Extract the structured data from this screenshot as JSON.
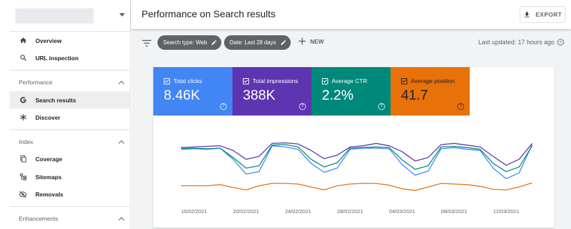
{
  "sidebar": {
    "items_top": [
      {
        "label": "Overview",
        "icon": "home-icon"
      },
      {
        "label": "URL inspection",
        "icon": "search-icon"
      }
    ],
    "sections": [
      {
        "label": "Performance",
        "items": [
          {
            "label": "Search results",
            "icon": "google-g-icon",
            "active": true
          },
          {
            "label": "Discover",
            "icon": "asterisk-icon"
          }
        ]
      },
      {
        "label": "Index",
        "items": [
          {
            "label": "Coverage",
            "icon": "copy-icon"
          },
          {
            "label": "Sitemaps",
            "icon": "sitemap-icon"
          },
          {
            "label": "Removals",
            "icon": "visibility-off-icon"
          }
        ]
      },
      {
        "label": "Enhancements",
        "items": []
      }
    ]
  },
  "header": {
    "title": "Performance on Search results",
    "export_label": "EXPORT"
  },
  "filters": {
    "chips": [
      "Search type: Web",
      "Date: Last 28 days"
    ],
    "new_label": "NEW",
    "last_updated": "Last updated: 17 hours ago"
  },
  "metrics": [
    {
      "label": "Total clicks",
      "value": "8.46K",
      "color": "#4285f4"
    },
    {
      "label": "Total impressions",
      "value": "388K",
      "color": "#5e35b1"
    },
    {
      "label": "Average CTR",
      "value": "2.2%",
      "color": "#00897b"
    },
    {
      "label": "Average position",
      "value": "41.7",
      "color": "#e8710a"
    }
  ],
  "chart_data": {
    "type": "line",
    "x": [
      "15/02/2021",
      "16/02/2021",
      "17/02/2021",
      "18/02/2021",
      "19/02/2021",
      "20/02/2021",
      "21/02/2021",
      "22/02/2021",
      "23/02/2021",
      "24/02/2021",
      "25/02/2021",
      "26/02/2021",
      "27/02/2021",
      "28/02/2021",
      "01/03/2021",
      "02/03/2021",
      "03/03/2021",
      "04/03/2021",
      "05/03/2021",
      "06/03/2021",
      "07/03/2021",
      "08/03/2021",
      "09/03/2021",
      "10/03/2021",
      "11/03/2021",
      "12/03/2021",
      "13/03/2021",
      "14/03/2021"
    ],
    "xtick_labels": [
      "16/02/2021",
      "20/02/2021",
      "24/02/2021",
      "28/02/2021",
      "04/03/2021",
      "08/03/2021",
      "12/03/2021"
    ],
    "xtick_indices": [
      1,
      5,
      9,
      13,
      17,
      21,
      25
    ],
    "series": [
      {
        "metric": "Total clicks",
        "color": "#4285f4",
        "values": [
          0.72,
          0.73,
          0.72,
          0.74,
          0.55,
          0.3,
          0.34,
          0.78,
          0.76,
          0.72,
          0.48,
          0.33,
          0.4,
          0.72,
          0.74,
          0.74,
          0.73,
          0.46,
          0.28,
          0.35,
          0.73,
          0.75,
          0.72,
          0.7,
          0.4,
          0.22,
          0.32,
          0.8
        ]
      },
      {
        "metric": "Total impressions",
        "color": "#5e35b1",
        "values": [
          0.75,
          0.76,
          0.77,
          0.78,
          0.7,
          0.55,
          0.6,
          0.82,
          0.83,
          0.81,
          0.7,
          0.56,
          0.62,
          0.76,
          0.78,
          0.82,
          0.78,
          0.68,
          0.52,
          0.58,
          0.8,
          0.82,
          0.79,
          0.76,
          0.6,
          0.45,
          0.55,
          0.82
        ]
      },
      {
        "metric": "Average CTR",
        "color": "#00897b",
        "values": [
          0.73,
          0.74,
          0.73,
          0.74,
          0.58,
          0.4,
          0.44,
          0.79,
          0.8,
          0.76,
          0.55,
          0.42,
          0.49,
          0.74,
          0.75,
          0.76,
          0.75,
          0.54,
          0.38,
          0.44,
          0.76,
          0.77,
          0.75,
          0.72,
          0.48,
          0.34,
          0.42,
          0.78
        ]
      },
      {
        "metric": "Average position",
        "color": "#e8710a",
        "values": [
          0.1,
          0.1,
          0.1,
          0.12,
          0.07,
          0.03,
          0.1,
          0.14,
          0.14,
          0.13,
          0.08,
          0.03,
          0.1,
          0.13,
          0.14,
          0.14,
          0.11,
          0.05,
          0.02,
          0.08,
          0.14,
          0.13,
          0.12,
          0.09,
          0.04,
          0.03,
          0.08,
          0.15
        ]
      }
    ],
    "ylim": [
      0,
      1
    ],
    "grid": false
  }
}
